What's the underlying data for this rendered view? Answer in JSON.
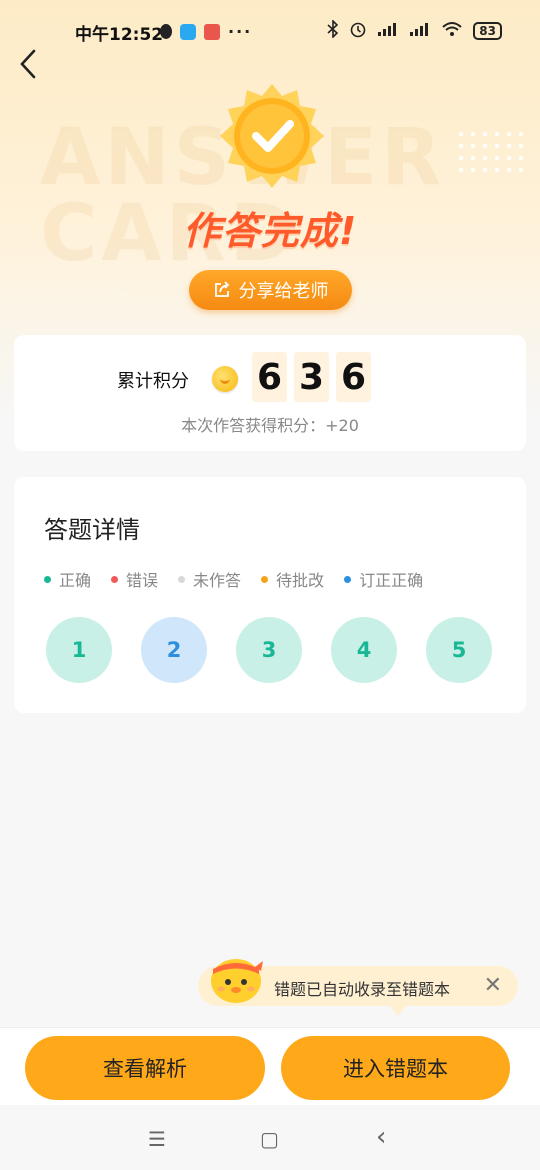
{
  "status_bar": {
    "time": "中午12:52",
    "more": "···",
    "battery": "83"
  },
  "hero": {
    "watermark_line1": "ANSWER",
    "watermark_line2": "CARD",
    "title": "作答完成!",
    "share_button": "分享给老师"
  },
  "score": {
    "label": "累计积分",
    "digits": [
      "6",
      "3",
      "6"
    ],
    "sub_text": "本次作答获得积分：+20"
  },
  "answer_detail": {
    "title": "答题详情",
    "legend": [
      {
        "label": "正确",
        "color": "#18b795"
      },
      {
        "label": "错误",
        "color": "#ef5a57"
      },
      {
        "label": "未作答",
        "color": "#d8d8d8"
      },
      {
        "label": "待批改",
        "color": "#f7a21a"
      },
      {
        "label": "订正正确",
        "color": "#2b8fe0"
      }
    ],
    "questions": [
      {
        "number": "1",
        "status": "正确"
      },
      {
        "number": "2",
        "status": "订正正确"
      },
      {
        "number": "3",
        "status": "正确"
      },
      {
        "number": "4",
        "status": "正确"
      },
      {
        "number": "5",
        "status": "正确"
      }
    ]
  },
  "tip": {
    "text": "错题已自动收录至错题本",
    "close": "✕"
  },
  "actions": {
    "view_analysis": "查看解析",
    "enter_wrong_book": "进入错题本"
  },
  "nav": {
    "menu": "☰",
    "home": "▢",
    "back": "‹"
  },
  "colors": {
    "accent": "#ffa91a",
    "title_red": "#ff5a2a",
    "correct": "#18b795",
    "fixed": "#2b8fe0"
  }
}
